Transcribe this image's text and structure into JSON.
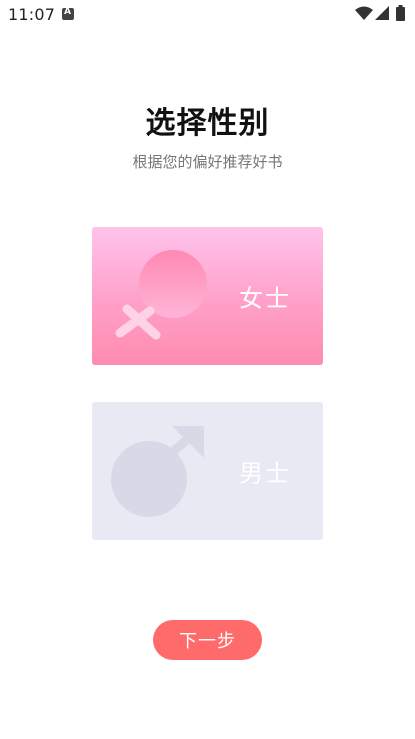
{
  "status_bar": {
    "time": "11:07",
    "icons": [
      "notification-a-icon",
      "wifi-icon",
      "signal-icon",
      "battery-icon"
    ]
  },
  "header": {
    "title": "选择性别",
    "subtitle": "根据您的偏好推荐好书"
  },
  "cards": {
    "female": {
      "label": "女士",
      "icon": "female-symbol-icon"
    },
    "male": {
      "label": "男士",
      "icon": "male-symbol-icon"
    }
  },
  "actions": {
    "next_label": "下一步"
  },
  "colors": {
    "female_card_top": "#ffc3ec",
    "female_card_bottom": "#ff8bb0",
    "male_card": "#e8e9f2",
    "next_button": "#ff6b6b"
  }
}
